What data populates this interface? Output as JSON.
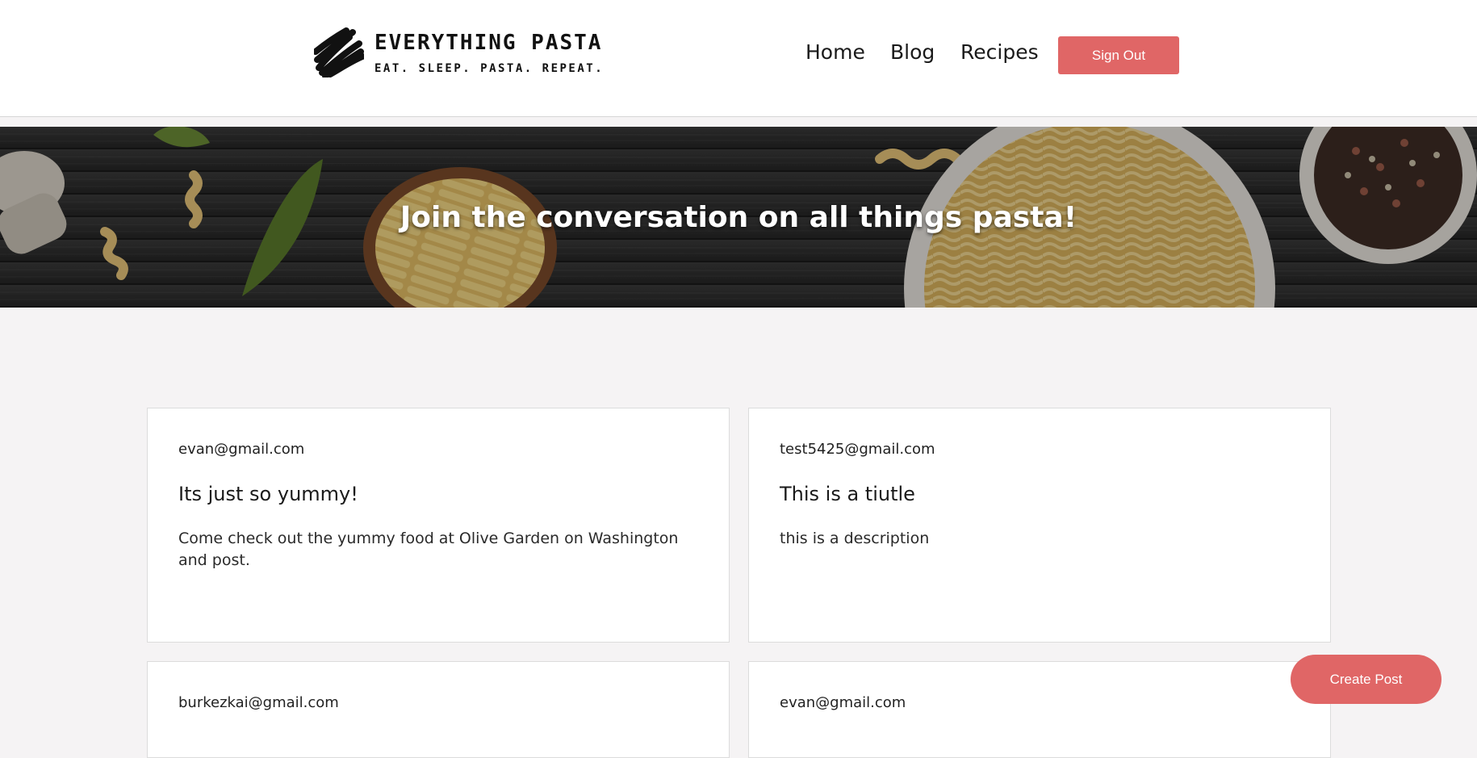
{
  "header": {
    "brand_title": "EVERYTHING PASTA",
    "brand_tagline": "EAT. SLEEP. PASTA. REPEAT.",
    "nav": [
      {
        "label": "Home"
      },
      {
        "label": "Blog"
      },
      {
        "label": "Recipes"
      }
    ],
    "signout_label": "Sign Out"
  },
  "hero": {
    "title": "Join the conversation on all things pasta!"
  },
  "posts": [
    {
      "author": "evan@gmail.com",
      "title": "Its just so yummy!",
      "body": "Come check out the yummy food at Olive Garden on Washington and post."
    },
    {
      "author": "test5425@gmail.com",
      "title": "This is a tiutle",
      "body": "this is a description"
    },
    {
      "author": "burkezkai@gmail.com"
    },
    {
      "author": "evan@gmail.com"
    }
  ],
  "create_post_label": "Create Post",
  "colors": {
    "accent": "#e06666",
    "page_background": "#f5f3f4",
    "card_background": "#ffffff"
  },
  "icons": {
    "logo": "brush-scribble-icon"
  }
}
